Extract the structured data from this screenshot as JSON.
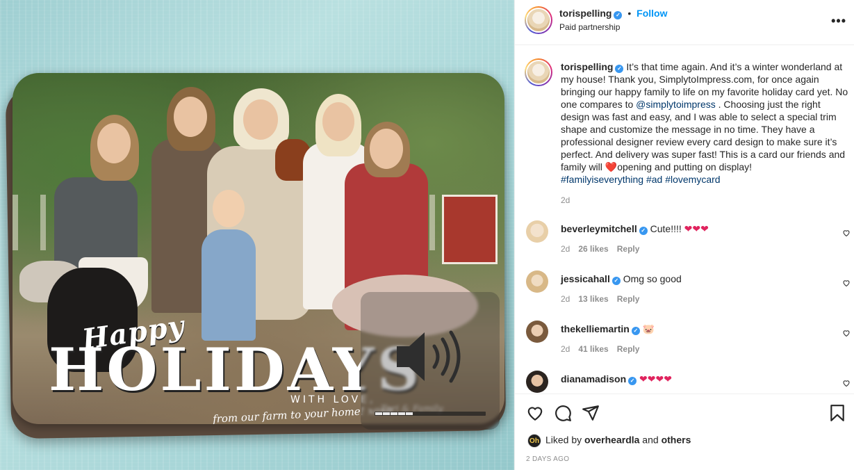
{
  "media": {
    "card_text": {
      "happy": "Happy",
      "holidays": "HOLIDAYS",
      "with_love": "WITH LOVE,",
      "from_farm": "from our farm to your home! xoxo",
      "signature": "Tori & Family"
    },
    "volume_overlay": {
      "icon": "speaker-volume-icon",
      "level": 0.125
    }
  },
  "header": {
    "username": "torispelling",
    "verified": true,
    "separator": "•",
    "follow_label": "Follow",
    "subtitle": "Paid partnership",
    "more_icon": "more-options-icon"
  },
  "caption": {
    "username": "torispelling",
    "text_1": "It’s that time again. And it’s a winter wonderland at my house! Thank you, SimplytoImpress.com, for once again bringing our happy family to life on my favorite holiday card yet. No one compares to ",
    "mention": "@simplytoimpress",
    "text_2": " . Choosing just the right design was fast and easy, and I was able to select a special trim shape and customize the message in no time. They have a professional designer review every card design to make sure it’s perfect. And delivery was super fast! This is a card our friends and family will ",
    "heart": "❤️",
    "text_3": "opening and putting on display!",
    "hashtags": [
      "#familyiseverything",
      "#ad",
      "#lovemycard"
    ],
    "age": "2d"
  },
  "comments": [
    {
      "username": "beverleymitchell",
      "text": "Cute!!!! ",
      "emoji": "❤❤❤",
      "age": "2d",
      "likes": "26 likes",
      "reply": "Reply"
    },
    {
      "username": "jessicahall",
      "text": "Omg so good",
      "emoji": "",
      "age": "2d",
      "likes": "13 likes",
      "reply": "Reply"
    },
    {
      "username": "thekelliemartin",
      "text": "",
      "emoji": "🐷",
      "age": "2d",
      "likes": "41 likes",
      "reply": "Reply"
    },
    {
      "username": "dianamadison",
      "text": "",
      "emoji": "❤❤❤❤",
      "age": "",
      "likes": "",
      "reply": ""
    }
  ],
  "actions": {
    "like_icon": "heart-outline-icon",
    "comment_icon": "comment-bubble-icon",
    "share_icon": "paper-plane-icon",
    "save_icon": "bookmark-icon",
    "liked_by_prefix": "Liked by ",
    "liked_by_user": "overheardla",
    "liked_by_and": " and ",
    "liked_by_others": "others",
    "liker_avatar_text": "Oh",
    "time_ago": "2 DAYS AGO"
  },
  "colors": {
    "link": "#00376b",
    "follow": "#0095f6",
    "verified": "#3897f0",
    "heart": "#e0245e"
  }
}
